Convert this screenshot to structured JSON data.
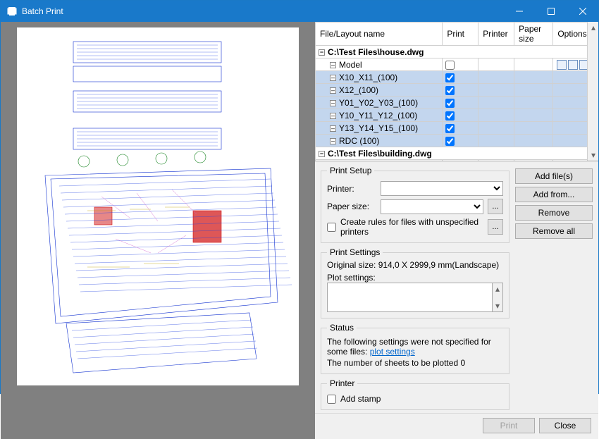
{
  "title": "Batch Print",
  "grid": {
    "columns": [
      "File/Layout name",
      "Print",
      "Printer",
      "Paper size",
      "Options"
    ],
    "file1": "C:\\Test Files\\house.dwg",
    "file2": "C:\\Test Files\\building.dwg",
    "model": "Model",
    "layouts1": [
      "X10_X11_(100)",
      "X12_(100)",
      "Y01_Y02_Y03_(100)",
      "Y10_Y11_Y12_(100)",
      "Y13_Y14_Y15_(100)",
      "RDC (100)"
    ]
  },
  "printSetup": {
    "legend": "Print Setup",
    "printer_label": "Printer:",
    "paper_label": "Paper size:",
    "create_rules_label": "Create rules for files with unspecified printers"
  },
  "buttons": {
    "add_files": "Add file(s)",
    "add_from": "Add from...",
    "remove": "Remove",
    "remove_all": "Remove all",
    "print": "Print",
    "close": "Close",
    "ellipsis": "..."
  },
  "printSettings": {
    "legend": "Print Settings",
    "original": "Original size:  914,0 X 2999,9 mm(Landscape)",
    "plot_label": "Plot settings:"
  },
  "status": {
    "legend": "Status",
    "line1_pre": "The following settings were not specified for some files: ",
    "line1_link": "plot settings",
    "line2": "The number of sheets to be plotted 0"
  },
  "printer": {
    "legend": "Printer",
    "stamp_label": "Add stamp"
  }
}
